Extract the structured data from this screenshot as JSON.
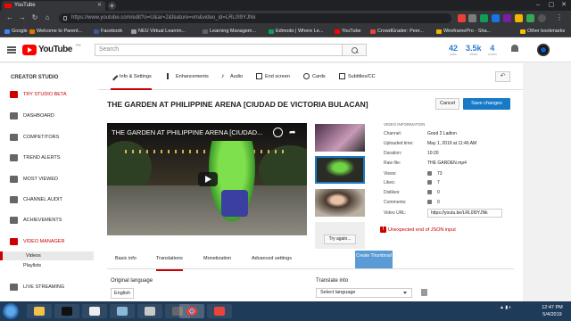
{
  "browser": {
    "tab_title": "YouTube",
    "url": "https://www.youtube.com/edit?o=U&ar=2&feature=vm&video_id=LRL0I9YJNk",
    "bookmarks": [
      {
        "label": "Google",
        "color": "#4285f4"
      },
      {
        "label": "Welcome to Parent...",
        "color": "#e37400"
      },
      {
        "label": "Facebook",
        "color": "#3b5998"
      },
      {
        "label": "NEU Virtual Learnin...",
        "color": "#9aa0a6"
      },
      {
        "label": "Learning Managem...",
        "color": "#5f6368"
      },
      {
        "label": "Edmodo | Where Le...",
        "color": "#0f9d58"
      },
      {
        "label": "YouTube",
        "color": "#ff0000"
      },
      {
        "label": "CrowdGrader: Peer...",
        "color": "#e8453c"
      },
      {
        "label": "WireframePro - Sha...",
        "color": "#f4b400"
      },
      {
        "label": "Other bookmarks",
        "color": "#fbbc04"
      }
    ]
  },
  "header": {
    "logo_text": "YouTube",
    "logo_suffix": "PH",
    "search_placeholder": "Search",
    "stats": [
      {
        "value": "42",
        "unit": "subs"
      },
      {
        "value": "3.5k",
        "unit": "views"
      },
      {
        "value": "4",
        "unit": "comm"
      }
    ]
  },
  "sidebar": {
    "title": "CREATOR STUDIO",
    "beta": "TRY STUDIO BETA",
    "items": [
      "DASHBOARD",
      "COMPETITORS",
      "TREND ALERTS",
      "MOST VIEWED",
      "CHANNEL AUDIT",
      "ACHIEVEMENTS",
      "VIDEO MANAGER"
    ],
    "subitems": [
      "Videos",
      "Playlists"
    ],
    "live": "LIVE STREAMING"
  },
  "tabs": [
    "Info & Settings",
    "Enhancements",
    "Audio",
    "End screen",
    "Cards",
    "Subtitles/CC"
  ],
  "video": {
    "title": "THE GARDEN AT PHILIPPINE ARENA [CIUDAD DE VICTORIA BULACAN]",
    "player_title": "THE GARDEN AT PHILIPPINE ARENA [CIUDAD...",
    "cancel": "Cancel",
    "save": "Save changes"
  },
  "thumbnails": {
    "try_again": "Try again...",
    "create": "Create Thumbnail"
  },
  "info": {
    "heading": "VIDEO INFORMATION",
    "channel_label": "Channel:",
    "channel": "Good 2 Ladion",
    "uploaded_label": "Uploaded time:",
    "uploaded": "May 1, 2019 at 11:46 AM",
    "duration_label": "Duration:",
    "duration": "10:20",
    "raw_label": "Raw file:",
    "raw": "THE GARDEN.mp4",
    "views_label": "Views:",
    "views": "73",
    "likes_label": "Likes:",
    "likes": "7",
    "dislikes_label": "Dislikes:",
    "dislikes": "0",
    "comments_label": "Comments:",
    "comments": "0",
    "url_label": "Video URL:",
    "url": "https://youtu.be/LRL0I9YJNk",
    "error": "Unexpected end of JSON input"
  },
  "bottom_tabs": [
    "Basic info",
    "Translations",
    "Monetization",
    "Advanced settings"
  ],
  "translations": {
    "original_label": "Original language",
    "original_value": "English",
    "translate_label": "Translate into",
    "translate_placeholder": "Select language"
  },
  "taskbar": {
    "time": "12:47 PM",
    "date": "5/4/2019"
  }
}
